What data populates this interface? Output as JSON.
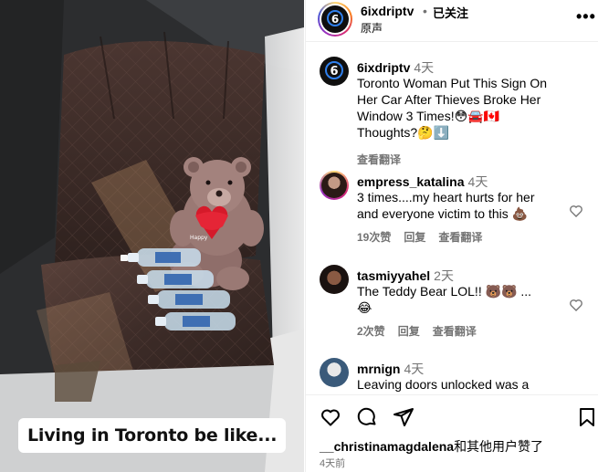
{
  "post": {
    "caption_overlay": "Living in Toronto be like..."
  },
  "header": {
    "username": "6ixdriptv",
    "separator": "•",
    "follow_status": "已关注",
    "audio": "原声",
    "more_icon": "more-icon"
  },
  "caption": {
    "username": "6ixdriptv",
    "time": "4天",
    "text_lines": [
      "Toronto Woman Put This Sign On",
      "Her Car After Thieves Broke Her",
      "Window 3 Times!😳🚘🇨🇦",
      "Thoughts?🤔⬇️"
    ],
    "translate": "查看翻译"
  },
  "comments": [
    {
      "username": "empress_katalina",
      "time": "4天",
      "text_lines": [
        "3 times....my heart hurts for her",
        "and everyone victim to this 💩"
      ],
      "likes": "19次赞",
      "reply": "回复",
      "translate": "查看翻译"
    },
    {
      "username": "tasmiyyahel",
      "time": "2天",
      "text_lines": [
        "The Teddy Bear LOL!! 🐻🐻 ...",
        "😂"
      ],
      "likes": "2次赞",
      "reply": "回复",
      "translate": "查看翻译"
    },
    {
      "username": "mrnign",
      "time": "4天",
      "text_lines": [
        "Leaving doors unlocked was a"
      ]
    }
  ],
  "footer": {
    "liked_by_user": "__christinamagdalena",
    "liked_by_suffix": "和其他用户赞了",
    "date": "4天前"
  },
  "colors": {
    "muted": "#737373",
    "border": "#efefef",
    "accent_blue": "#2f80ed"
  }
}
